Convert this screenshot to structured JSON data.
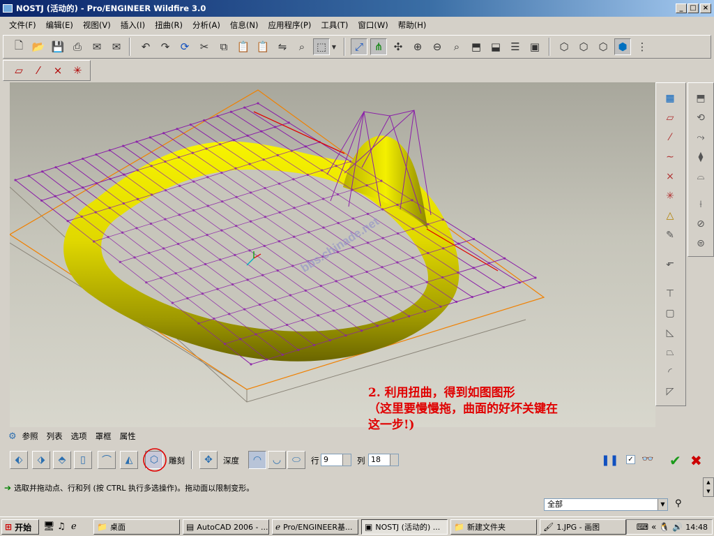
{
  "window": {
    "title": "NOSTJ (活动的) - Pro/ENGINEER Wildfire 3.0"
  },
  "menu": [
    "文件(F)",
    "编辑(E)",
    "视图(V)",
    "插入(I)",
    "扭曲(R)",
    "分析(A)",
    "信息(N)",
    "应用程序(P)",
    "工具(T)",
    "窗口(W)",
    "帮助(H)"
  ],
  "annotation": {
    "line1": "2. 利用扭曲，得到如图图形",
    "line2": "（这里要慢慢拖，曲面的好坏关键在",
    "line3": "这一步!)"
  },
  "watermark": "bbs.chinade.net",
  "dashboard": {
    "tabs": [
      "参照",
      "列表",
      "选项",
      "罩框",
      "属性"
    ],
    "sculpt_label": "雕刻",
    "depth_label": "深度",
    "row_label": "行",
    "row_value": "9",
    "col_label": "列",
    "col_value": "18",
    "checkbox_checked": true
  },
  "status": {
    "message": "选取并拖动点、行和列 (按 CTRL 执行多选操作)。拖动面以限制变形。"
  },
  "filter": {
    "value": "全部"
  },
  "taskbar": {
    "start": "开始",
    "tasks": [
      "桌面",
      "AutoCAD 2006 - ...",
      "Pro/ENGINEER基...",
      "NOSTJ (活动的) ...",
      "新建文件夹",
      "1.JPG - 画图"
    ],
    "active_task": "NOSTJ (活动的) ...",
    "clock": "14:48"
  },
  "colors": {
    "title_bar": "#0a246a",
    "annotation": "#e00000",
    "surface": "#e8e400",
    "mesh": "#8a1fa8",
    "ok": "#1a9a1a",
    "cancel": "#cc0000"
  }
}
